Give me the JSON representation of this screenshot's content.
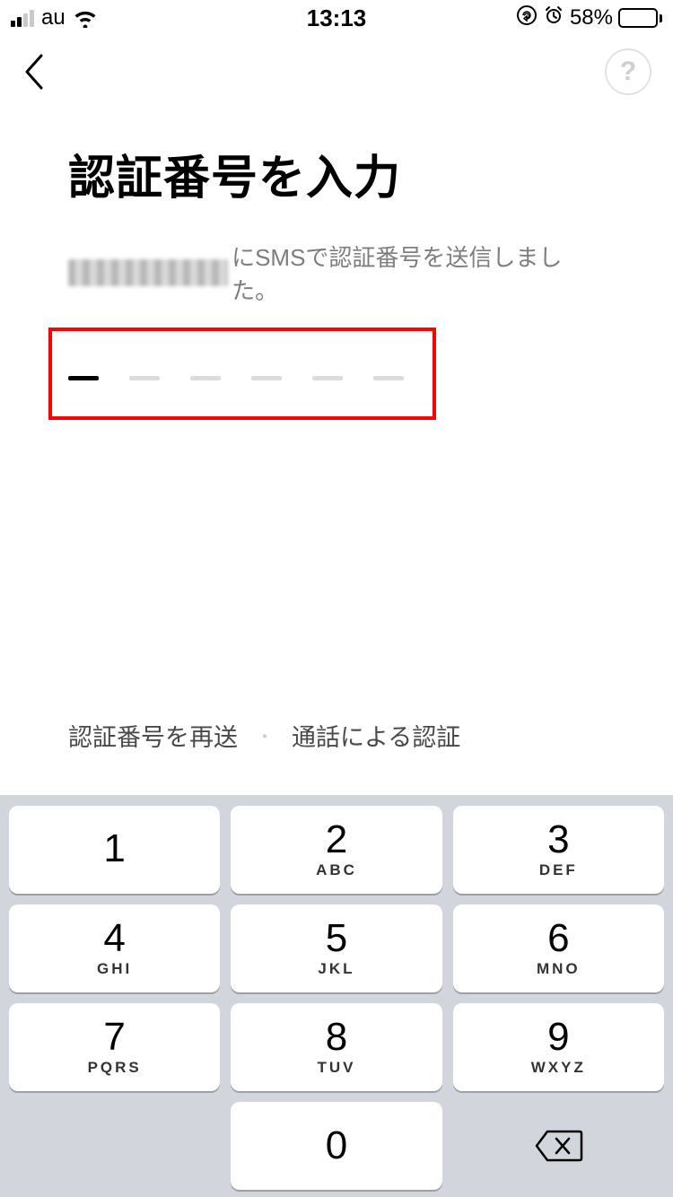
{
  "status": {
    "carrier": "au",
    "time": "13:13",
    "battery_pct": "58%"
  },
  "nav": {
    "help_label": "?"
  },
  "page": {
    "title": "認証番号を入力",
    "subtitle_suffix": "にSMSで認証番号を送信しました。"
  },
  "code_input": {
    "length": 6,
    "filled": 0,
    "active_index": 0
  },
  "actions": {
    "resend": "認証番号を再送",
    "separator": "・",
    "call_auth": "通話による認証"
  },
  "keypad": {
    "rows": [
      [
        {
          "num": "1",
          "sub": ""
        },
        {
          "num": "2",
          "sub": "ABC"
        },
        {
          "num": "3",
          "sub": "DEF"
        }
      ],
      [
        {
          "num": "4",
          "sub": "GHI"
        },
        {
          "num": "5",
          "sub": "JKL"
        },
        {
          "num": "6",
          "sub": "MNO"
        }
      ],
      [
        {
          "num": "7",
          "sub": "PQRS"
        },
        {
          "num": "8",
          "sub": "TUV"
        },
        {
          "num": "9",
          "sub": "WXYZ"
        }
      ]
    ],
    "zero": {
      "num": "0",
      "sub": ""
    }
  }
}
